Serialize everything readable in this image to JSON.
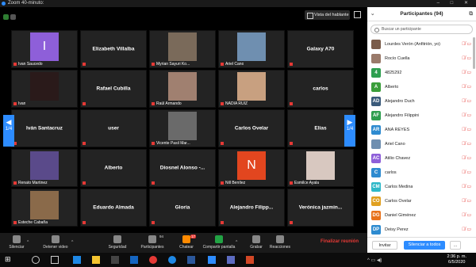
{
  "window": {
    "title": "Zoom 40-minuto:",
    "controls": "–  □  ✕"
  },
  "view": {
    "speaker_view_label": "Vista del hablante"
  },
  "grid": {
    "tiles": [
      {
        "name": "",
        "caption": "Ivan Saucedo",
        "photo": "letter",
        "letter": "I",
        "color": "#8e5fd9"
      },
      {
        "name": "Elizabeth Villalba",
        "caption": "",
        "photo": ""
      },
      {
        "name": "",
        "caption": "Myrian Sayuri Ko...",
        "photo": "pic",
        "color": "#7a6a5a"
      },
      {
        "name": "",
        "caption": "Ariel Cano",
        "photo": "pic",
        "color": "#6f8fb0"
      },
      {
        "name": "Galaxy A70",
        "caption": "",
        "photo": ""
      },
      {
        "name": "",
        "caption": "Ivan",
        "photo": "pic",
        "color": "#2a1a1a"
      },
      {
        "name": "Rafael Cubilla",
        "caption": "",
        "photo": ""
      },
      {
        "name": "",
        "caption": "Raúl Armando",
        "photo": "pic",
        "color": "#a08070"
      },
      {
        "name": "",
        "caption": "NADIA RUIZ",
        "photo": "pic",
        "color": "#c8a080"
      },
      {
        "name": "carlos",
        "caption": "",
        "photo": ""
      },
      {
        "name": "Iván Santacruz",
        "caption": "",
        "photo": ""
      },
      {
        "name": "user",
        "caption": "",
        "photo": ""
      },
      {
        "name": "",
        "caption": "Vicente Pasil Mar...",
        "photo": "pic",
        "color": "#6a6a6a"
      },
      {
        "name": "Carlos Ovelar",
        "caption": "",
        "photo": ""
      },
      {
        "name": "Elias",
        "caption": "",
        "photo": ""
      },
      {
        "name": "",
        "caption": "Renato Martinez",
        "photo": "pic",
        "color": "#5a4a8a"
      },
      {
        "name": "Alberto",
        "caption": "",
        "photo": ""
      },
      {
        "name": "Diosnel Alonso -...",
        "caption": "",
        "photo": ""
      },
      {
        "name": "",
        "caption": "Nill Benítez",
        "photo": "letter",
        "letter": "N",
        "color": "#e2461f"
      },
      {
        "name": "",
        "caption": "Esmilce Ayala",
        "photo": "pic",
        "color": "#d8c8c0"
      },
      {
        "name": "",
        "caption": "Esteche Cabaña",
        "photo": "pic",
        "color": "#8a6a4a"
      },
      {
        "name": "Eduardo Almada",
        "caption": "",
        "photo": ""
      },
      {
        "name": "Gloria",
        "caption": "",
        "photo": ""
      },
      {
        "name": "Alejandro  Filipp...",
        "caption": "",
        "photo": ""
      },
      {
        "name": "Verónica  jazmin...",
        "caption": "",
        "photo": ""
      }
    ],
    "page_left": "1/4",
    "page_right": "1/4"
  },
  "toolbar": {
    "mute": "Silenciar",
    "video": "Detener video",
    "security": "Seguridad",
    "participants": "Participantes",
    "participants_count": "94",
    "chat": "Chatear",
    "chat_count": "17",
    "share": "Compartir pantalla",
    "record": "Grabar",
    "reactions": "Reacciones",
    "end": "Finalizar reunión"
  },
  "panel": {
    "title": "Participantes (94)",
    "search_placeholder": "Buscar un participante",
    "participants": [
      {
        "initials": "",
        "name": "Lourdes Verón (Anfitrión, yo)",
        "color": "#7a5c4a"
      },
      {
        "initials": "",
        "name": "Rocío Cuella",
        "color": "#9a7a6a"
      },
      {
        "initials": "4",
        "name": "4825292",
        "color": "#2e9e4f"
      },
      {
        "initials": "A",
        "name": "Alberto",
        "color": "#3a9e3a"
      },
      {
        "initials": "AD",
        "name": "Alejandro Duch",
        "color": "#3a5a7a"
      },
      {
        "initials": "AF",
        "name": "Alejandro Filippini",
        "color": "#2e9e4f"
      },
      {
        "initials": "AR",
        "name": "ANA REYES",
        "color": "#2e8bd0"
      },
      {
        "initials": "",
        "name": "Ariel Cano",
        "color": "#6f8fb0"
      },
      {
        "initials": "AC",
        "name": "Atilio Chavez",
        "color": "#8e5fd9"
      },
      {
        "initials": "C",
        "name": "carlos",
        "color": "#2e8bd0"
      },
      {
        "initials": "CM",
        "name": "Carlos Medina",
        "color": "#2eb8c8"
      },
      {
        "initials": "CO",
        "name": "Carlos Ovelar",
        "color": "#e0a020"
      },
      {
        "initials": "DG",
        "name": "Daniel Giménez",
        "color": "#e8721c"
      },
      {
        "initials": "DP",
        "name": "Deisy Perez",
        "color": "#2e8bd0"
      }
    ],
    "invite": "Invitar",
    "mute_all": "Silenciar a todos",
    "more": "..."
  },
  "taskbar": {
    "time": "2:36 p. m.",
    "date": "6/5/2020",
    "tray": "^ ▭ ◀)"
  }
}
